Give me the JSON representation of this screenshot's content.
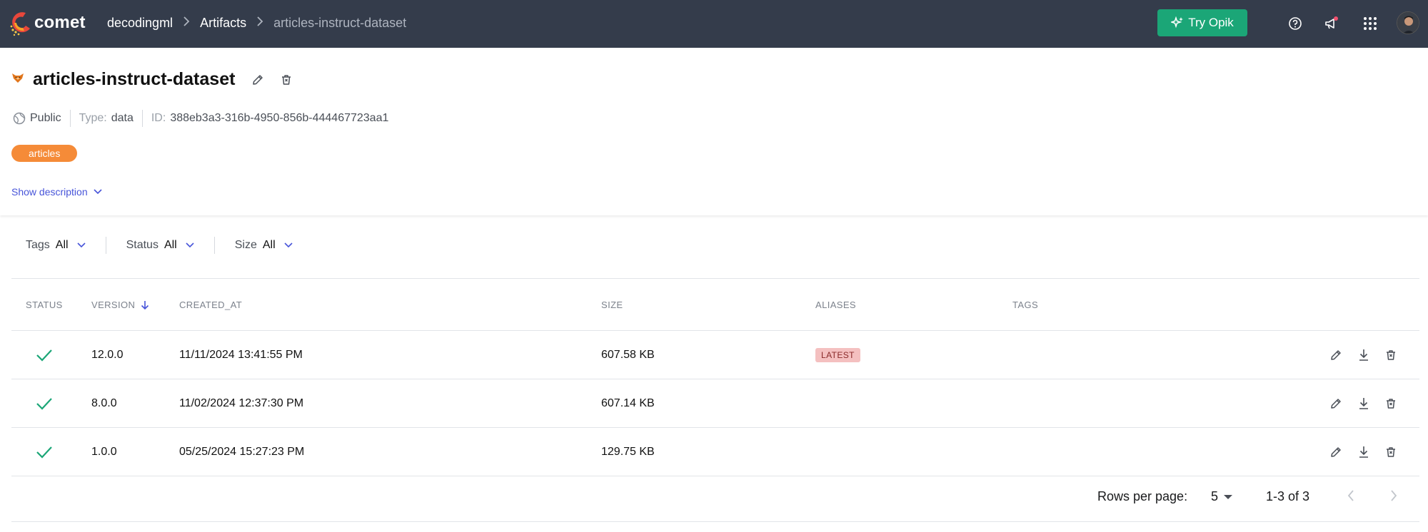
{
  "app": {
    "logo_text": "comet",
    "breadcrumbs": [
      "decodingml",
      "Artifacts",
      "articles-instruct-dataset"
    ],
    "try_button_label": "Try Opik",
    "icons": [
      "help-icon",
      "announcement-icon",
      "apps-grid-icon",
      "user-avatar"
    ]
  },
  "artifact": {
    "name": "articles-instruct-dataset",
    "visibility": "Public",
    "type_label": "Type:",
    "type_value": "data",
    "id_label": "ID:",
    "id_value": "388eb3a3-316b-4950-856b-444467723aa1",
    "tags": [
      "articles"
    ],
    "show_description_label": "Show description"
  },
  "filters": [
    {
      "label": "Tags",
      "value": "All"
    },
    {
      "label": "Status",
      "value": "All"
    },
    {
      "label": "Size",
      "value": "All"
    }
  ],
  "table": {
    "columns": [
      "STATUS",
      "VERSION",
      "CREATED_AT",
      "SIZE",
      "ALIASES",
      "TAGS"
    ],
    "rows": [
      {
        "version": "12.0.0",
        "created_at": "11/11/2024 13:41:55 PM",
        "size": "607.58 KB",
        "alias": "LATEST"
      },
      {
        "version": "8.0.0",
        "created_at": "11/02/2024 12:37:30 PM",
        "size": "607.14 KB",
        "alias": ""
      },
      {
        "version": "1.0.0",
        "created_at": "05/25/2024 15:27:23 PM",
        "size": "129.75 KB",
        "alias": ""
      }
    ]
  },
  "pagination": {
    "rows_per_page_label": "Rows per page:",
    "rows_per_page_value": "5",
    "range": "1-3 of 3"
  },
  "colors": {
    "nav_bg": "#343c4b",
    "accent_green": "#1ba677",
    "tag_orange": "#f58b38",
    "link_blue": "#4754d9",
    "latest_badge": "#f4c0c0"
  }
}
